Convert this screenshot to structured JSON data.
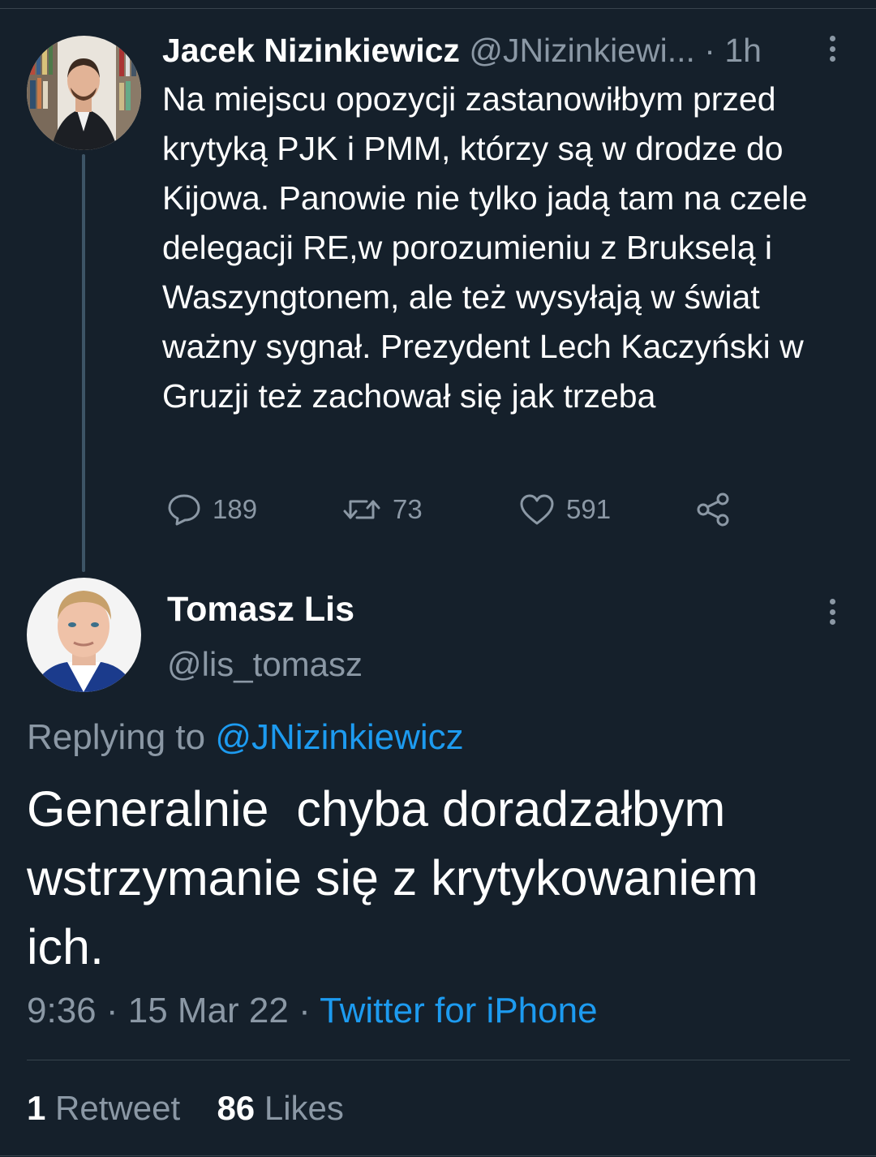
{
  "parent_tweet": {
    "author_name": "Jacek Nizinkiewicz",
    "handle": "@JNizinkiewi...",
    "separator": " · ",
    "time": "1h",
    "text": "Na miejscu opozycji zastanowiłbym przed krytyką PJK i PMM, którzy są w drodze do Kijowa. Panowie nie tylko jadą tam na czele delegacji RE,w porozumieniu z Brukselą i Waszyngtonem, ale też wysyłają w świat ważny sygnał. Prezydent Lech Kaczyński w Gruzji też zachował się jak trzeba",
    "reply_count": "189",
    "retweet_count": "73",
    "like_count": "591",
    "icons": [
      "reply-icon",
      "retweet-icon",
      "like-icon",
      "share-icon",
      "more-icon"
    ]
  },
  "main_tweet": {
    "author_name": "Tomasz Lis",
    "handle": "@lis_tomasz",
    "replying_prefix": "Replying to",
    "replying_to": "@JNizinkiewicz",
    "text": "Generalnie  chyba doradzałbym wstrzymanie się z krytykowaniem ich.",
    "time": "9:36",
    "dot1": " · ",
    "date": "15 Mar 22",
    "dot2": " · ",
    "source": "Twitter for iPhone",
    "retweets_count": "1",
    "retweets_label": "Retweet",
    "likes_count": "86",
    "likes_label": "Likes"
  },
  "colors": {
    "background": "#15202b",
    "text": "#ffffff",
    "muted": "#8b98a5",
    "link": "#1d9bf0",
    "divider": "#38444d"
  }
}
